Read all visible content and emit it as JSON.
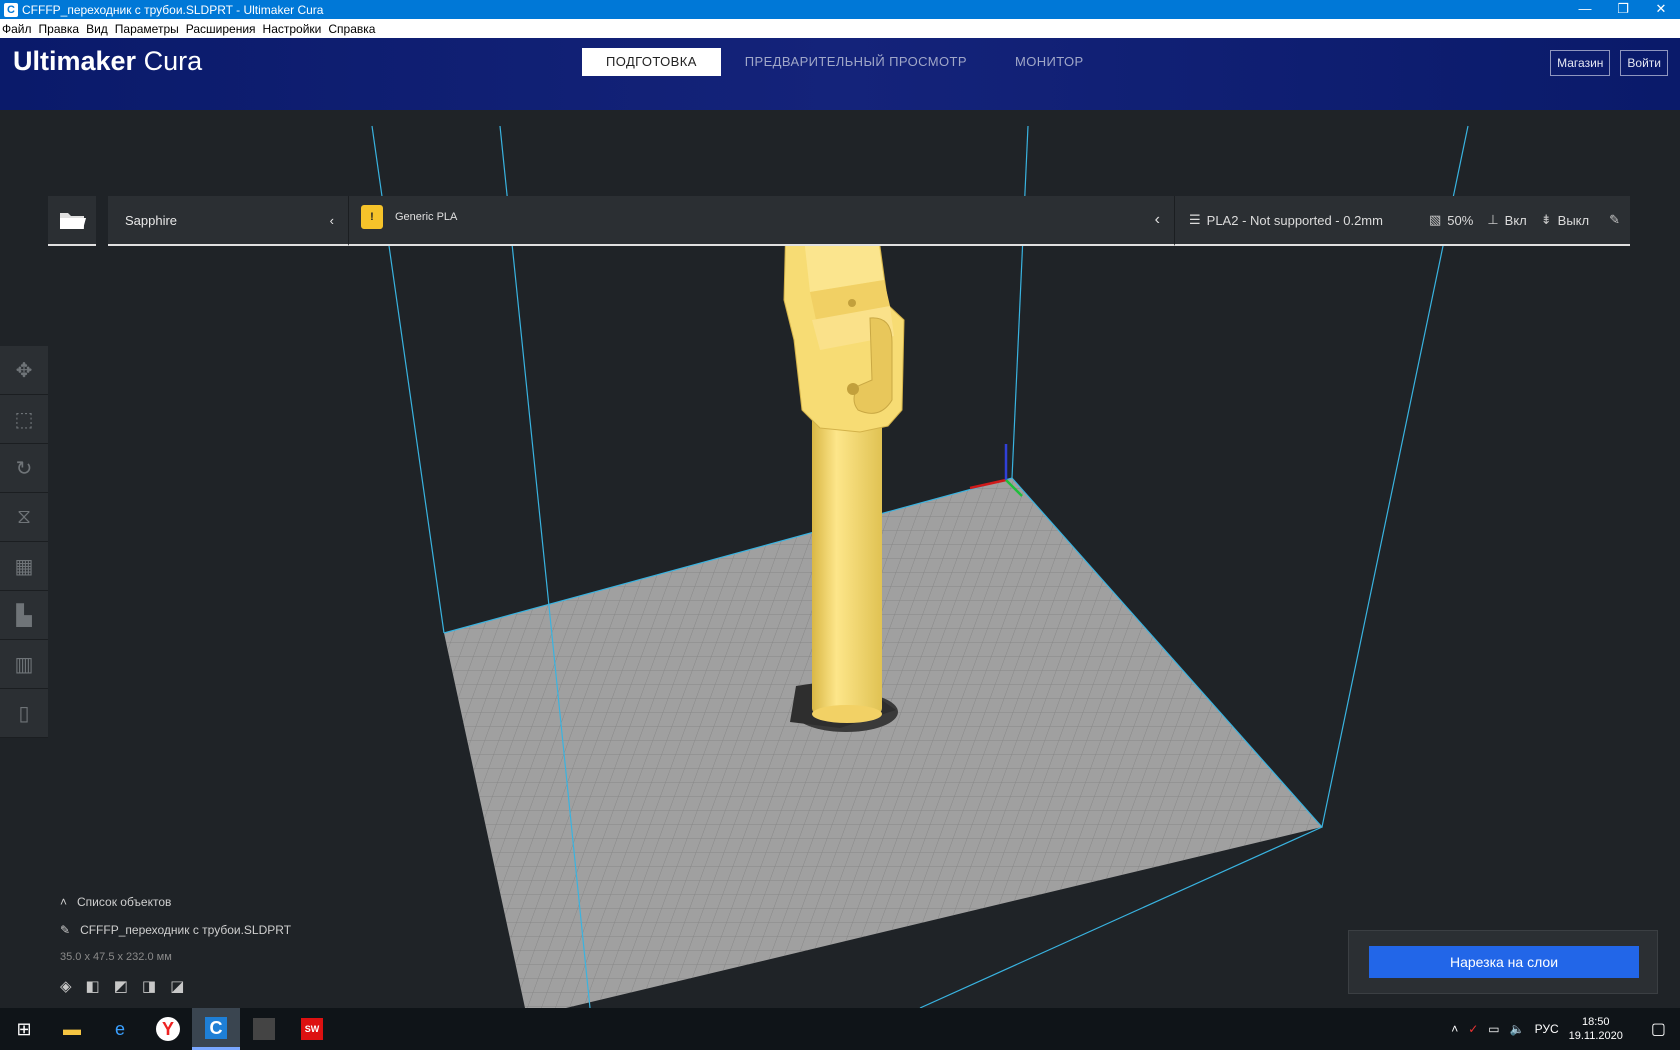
{
  "window": {
    "title": "CFFFP_переходник с трубои.SLDPRT - Ultimaker Cura",
    "controls": [
      "—",
      "❐",
      "✕"
    ]
  },
  "menu": [
    "Файл",
    "Правка",
    "Вид",
    "Параметры",
    "Расширения",
    "Настройки",
    "Справка"
  ],
  "header": {
    "logo_bold": "Ultimaker",
    "logo_light": "Cura",
    "tabs": [
      "ПОДГОТОВКА",
      "ПРЕДВАРИТЕЛЬНЫЙ ПРОСМОТР",
      "МОНИТОР"
    ],
    "active_tab": 0,
    "store": "Магазин",
    "login": "Войти"
  },
  "toolbar": {
    "printer": "Sapphire",
    "material": "Generic PLA",
    "profile": "PLA2 - Not supported - 0.2mm",
    "infill": "50%",
    "support": "Вкл",
    "adhesion": "Выкл"
  },
  "objects": {
    "title": "Список объектов",
    "name": "CFFFP_переходник с трубои.SLDPRT",
    "dims": "35.0 x 47.5 x 232.0 мм"
  },
  "slice_button": "Нарезка на слои",
  "tray": {
    "lang": "РУС",
    "time": "18:50",
    "date": "19.11.2020"
  },
  "colors": {
    "header": "#14237a",
    "accent": "#2266e8",
    "model": "#f6d873",
    "build_plate": "#9e9e9e",
    "volume_lines": "#39b3e0"
  }
}
